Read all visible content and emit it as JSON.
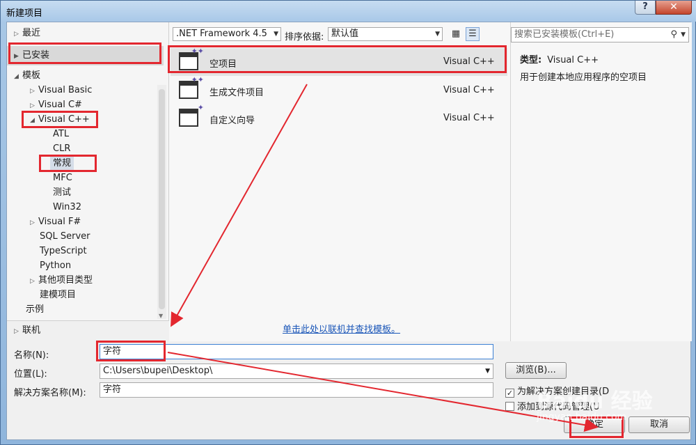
{
  "window": {
    "title": "新建项目",
    "help": "?",
    "close": "✕"
  },
  "tree": {
    "recent": "最近",
    "installed": "已安装",
    "templates": "模板",
    "items": [
      "Visual Basic",
      "Visual C#",
      "Visual C++",
      "ATL",
      "CLR",
      "常规",
      "MFC",
      "测试",
      "Win32",
      "Visual F#",
      "SQL Server",
      "TypeScript",
      "Python",
      "其他项目类型",
      "建模项目"
    ],
    "samples": "示例",
    "online": "联机"
  },
  "toolbar": {
    "framework": ".NET Framework 4.5",
    "sort_label": "排序依据:",
    "sort_value": "默认值",
    "grid_icon": "grid-view-icon",
    "list_icon": "list-view-icon"
  },
  "templates": [
    {
      "name": "空项目",
      "lang": "Visual C++"
    },
    {
      "name": "生成文件项目",
      "lang": "Visual C++"
    },
    {
      "name": "自定义向导",
      "lang": "Visual C++"
    }
  ],
  "online_link": "单击此处以联机并查找模板。",
  "search": {
    "placeholder": "搜索已安装模板(Ctrl+E)"
  },
  "info": {
    "type_label": "类型:",
    "type_value": "Visual C++",
    "desc": "用于创建本地应用程序的空项目"
  },
  "form": {
    "name_label": "名称(N):",
    "name_value": "字符",
    "location_label": "位置(L):",
    "location_value": "C:\\Users\\bupei\\Desktop\\",
    "solution_label": "解决方案名称(M):",
    "solution_value": "字符",
    "browse": "浏览(B)...",
    "create_dir": "为解决方案创建目录(D",
    "add_source": "添加到源代码管理(U",
    "ok": "确定",
    "cancel": "取消"
  },
  "watermark": {
    "brand": "Baidu 经验",
    "url": "jingyan.baidu.com"
  },
  "colors": {
    "highlight": "#e3272f",
    "link": "#1a56b8",
    "titlebar": "#a9c8e8"
  }
}
